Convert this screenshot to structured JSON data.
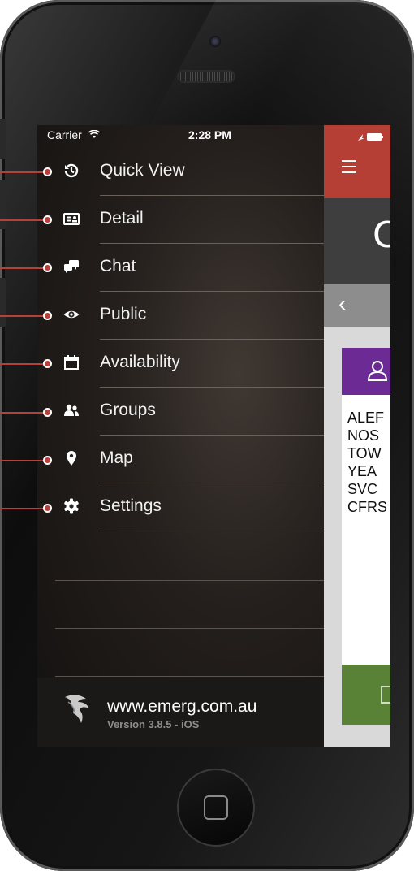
{
  "status_bar": {
    "carrier": "Carrier",
    "wifi_icon": "wifi-icon",
    "time": "2:28 PM"
  },
  "menu": {
    "items": [
      {
        "label": "Quick View",
        "icon": "history-icon"
      },
      {
        "label": "Detail",
        "icon": "id-card-icon"
      },
      {
        "label": "Chat",
        "icon": "chat-icon"
      },
      {
        "label": "Public",
        "icon": "eye-icon"
      },
      {
        "label": "Availability",
        "icon": "calendar-icon"
      },
      {
        "label": "Groups",
        "icon": "users-icon"
      },
      {
        "label": "Map",
        "icon": "map-pin-icon"
      },
      {
        "label": "Settings",
        "icon": "gear-icon"
      }
    ]
  },
  "footer": {
    "url": "www.emerg.com.au",
    "version": "Version 3.8.5 - iOS"
  },
  "app_peek": {
    "big_char": "C",
    "back_icon": "chevron-left-icon",
    "alert_lines": "ALEF\nNOS\nTOW\nYEA\nSVC\nCFRS"
  },
  "colors": {
    "accent_red": "#b53e35",
    "purple": "#6b2a94",
    "green": "#5a8236"
  }
}
